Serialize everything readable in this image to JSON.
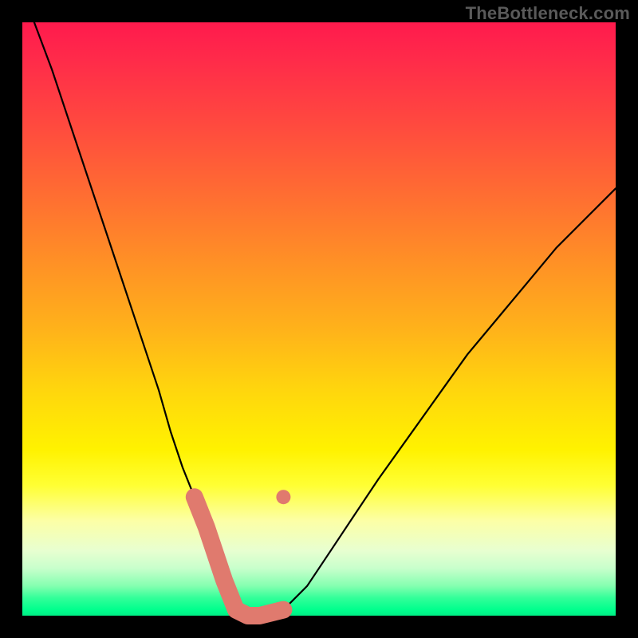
{
  "attribution": "TheBottleneck.com",
  "colors": {
    "background": "#000000",
    "gradient_top": "#ff1a4d",
    "gradient_mid": "#fff200",
    "gradient_bottom": "#00ef85",
    "curve": "#000000",
    "valley_highlight": "#e07a6e"
  },
  "chart_data": {
    "type": "line",
    "title": "",
    "xlabel": "",
    "ylabel": "",
    "xlim": [
      0,
      100
    ],
    "ylim": [
      0,
      100
    ],
    "series": [
      {
        "name": "bottleneck-curve",
        "x": [
          2,
          5,
          8,
          11,
          14,
          17,
          20,
          23,
          25,
          27,
          29,
          31,
          32,
          34,
          36,
          38,
          40,
          44,
          48,
          52,
          56,
          60,
          65,
          70,
          75,
          80,
          85,
          90,
          95,
          100
        ],
        "values": [
          100,
          92,
          83,
          74,
          65,
          56,
          47,
          38,
          31,
          25,
          20,
          15,
          12,
          6,
          1,
          0,
          0,
          1,
          5,
          11,
          17,
          23,
          30,
          37,
          44,
          50,
          56,
          62,
          67,
          72
        ]
      }
    ],
    "highlight_segment": {
      "name": "valley",
      "x": [
        29,
        31,
        32,
        34,
        36,
        38,
        40,
        44
      ],
      "values": [
        20,
        15,
        12,
        6,
        1,
        0,
        0,
        1
      ]
    },
    "markers": [
      {
        "x": 29,
        "y": 20
      },
      {
        "x": 44,
        "y": 20
      }
    ]
  }
}
